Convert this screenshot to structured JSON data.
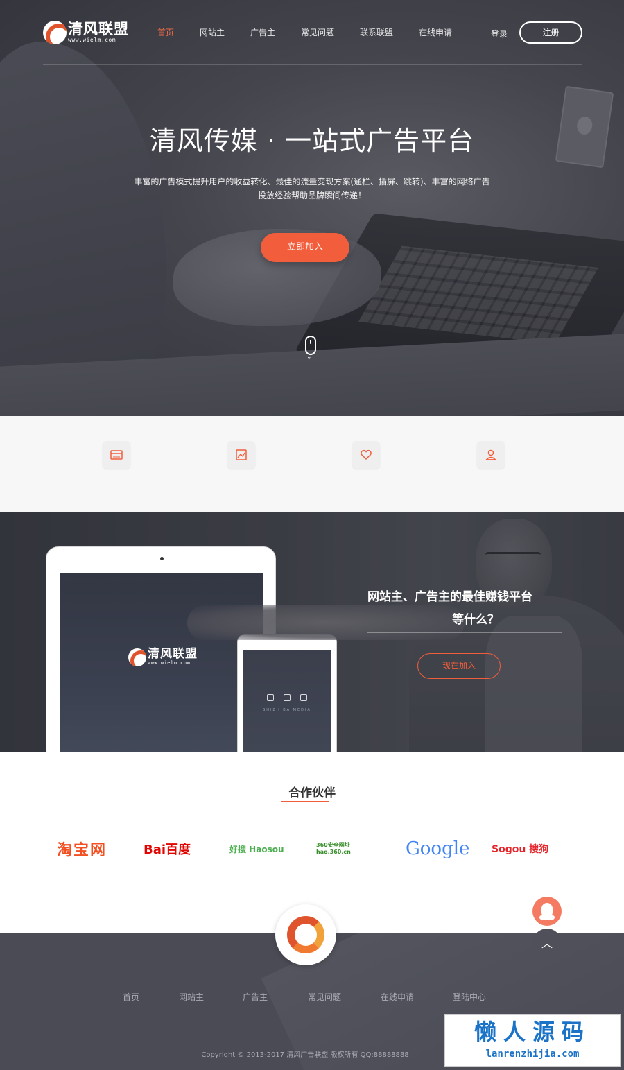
{
  "brand": {
    "name": "清风联盟",
    "url": "www.wielm.com"
  },
  "nav": {
    "items": [
      "首页",
      "网站主",
      "广告主",
      "常见问题",
      "联系联盟",
      "在线申请"
    ],
    "active_index": 0,
    "login": "登录",
    "register": "注册"
  },
  "hero": {
    "title": "清风传媒 · 一站式广告平台",
    "desc_line1": "丰富的广告模式提升用户的收益转化、最佳的流量变现方案(通栏、插屏、跳转)、丰富的网络广告",
    "desc_line2": "投放经验帮助品牌瞬间传递！",
    "cta": "立即加入"
  },
  "features": {
    "icons": [
      "window-icon",
      "image-icon",
      "heart-icon",
      "user-icon"
    ]
  },
  "promo": {
    "line1": "网站主、广告主的最佳赚钱平台",
    "line2": "等什么？",
    "button": "现在加入",
    "phone_tag": "SHIZHIBA MEDIA"
  },
  "partners": {
    "title": "合作伙伴",
    "items": [
      {
        "name": "淘宝网",
        "color": "#f25022"
      },
      {
        "name": "Bai百度",
        "color": "#e10602"
      },
      {
        "name": "好搜 Haosou",
        "color": "#4caf50"
      },
      {
        "name": "360安全网址 hao.360.cn",
        "color": "#3a8e2c"
      },
      {
        "name": "Google",
        "color": "#4285f4"
      },
      {
        "name": "Sogou 搜狗",
        "color": "#e6252b"
      }
    ]
  },
  "footer": {
    "nav": [
      "首页",
      "网站主",
      "广告主",
      "常见问题",
      "在线申请",
      "登陆中心"
    ],
    "copyright": "Copyright © 2013-2017 清风广告联盟 版权所有 QQ:88888888"
  },
  "watermark": {
    "title": "懒人源码",
    "url": "lanrenzhijia.com"
  },
  "colors": {
    "accent": "#f25d3c",
    "dark_bg": "#4a4b55",
    "watermark_blue": "#1b73c8"
  }
}
